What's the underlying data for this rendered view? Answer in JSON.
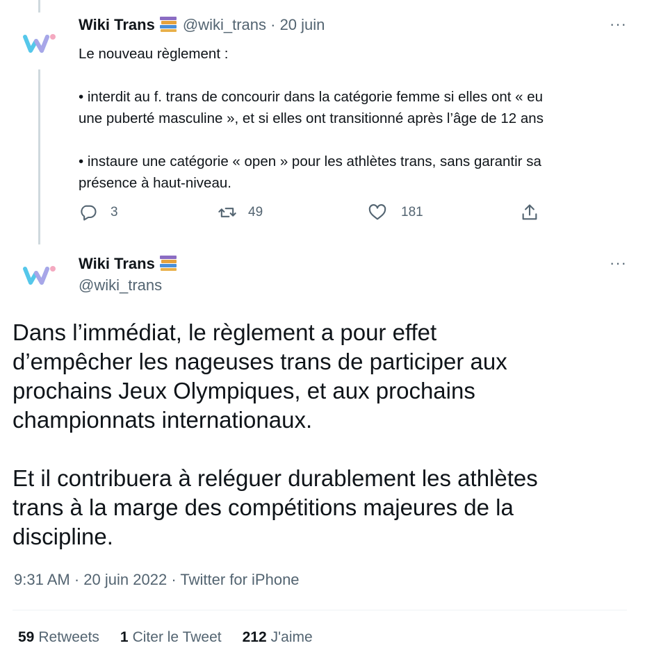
{
  "reply_tweet": {
    "display_name": "Wiki Trans",
    "handle": "@wiki_trans",
    "separator": "·",
    "date": "20 juin",
    "more": "···",
    "paragraphs": [
      [
        "Le nouveau règlement :"
      ],
      [
        "• interdit au f. trans de concourir dans la catégorie femme si elles ont « eu",
        "une puberté masculine », et si elles ont transitionné après l’âge de 12 ans"
      ],
      [
        "• instaure une catégorie « open » pour les athlètes trans, sans garantir sa",
        "présence à haut-niveau."
      ]
    ],
    "replies": "3",
    "retweets": "49",
    "likes": "181"
  },
  "main_tweet": {
    "display_name": "Wiki Trans",
    "handle": "@wiki_trans",
    "more": "···",
    "paragraphs": [
      [
        "Dans l’immédiat, le règlement a pour effet",
        "d’empêcher les nageuses trans de participer aux",
        "prochains Jeux Olympiques, et aux prochains",
        "championnats internationaux."
      ],
      [
        "Et il contribuera à reléguer durablement les athlètes",
        "trans à la marge des compétitions majeures de la",
        "discipline."
      ]
    ],
    "time": "9:31 AM",
    "separator": "·",
    "date": "20 juin 2022",
    "client": "Twitter for iPhone",
    "stats": {
      "retweets_count": "59",
      "retweets_label": "Retweets",
      "quotes_count": "1",
      "quotes_label": "Citer le Tweet",
      "likes_count": "212",
      "likes_label": "J'aime"
    }
  },
  "colors": {
    "text": "#0f1419",
    "muted": "#536471",
    "thread_line": "#cfd9de",
    "logo_blue": "#55c7ea",
    "logo_pink": "#f4a9c0"
  },
  "icons": [
    "wiki-trans-logo-icon",
    "books-emoji-icon",
    "more-icon",
    "reply-icon",
    "retweet-icon",
    "like-icon",
    "share-icon"
  ]
}
